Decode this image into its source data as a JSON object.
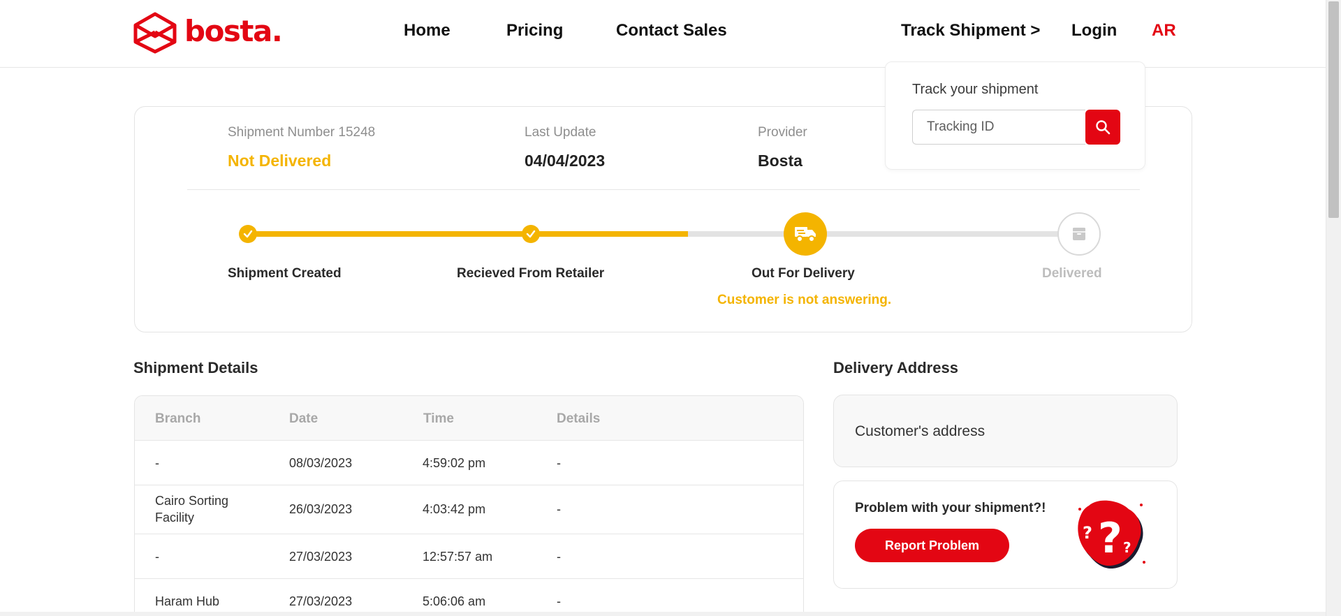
{
  "header": {
    "logo_text": "bosta",
    "nav": {
      "home": "Home",
      "pricing": "Pricing",
      "contact_sales": "Contact Sales",
      "track_shipment": "Track Shipment >",
      "login": "Login",
      "language": "AR"
    }
  },
  "track_popup": {
    "title": "Track your shipment",
    "input_placeholder": "Tracking ID",
    "search_icon": "search-icon"
  },
  "shipment": {
    "number_label": "Shipment Number 15248",
    "status": "Not Delivered",
    "last_update_label": "Last Update",
    "last_update_value": "04/04/2023",
    "provider_label": "Provider",
    "provider_value": "Bosta"
  },
  "progress": {
    "steps": [
      {
        "label": "Shipment Created",
        "state": "done",
        "icon": "check-icon"
      },
      {
        "label": "Recieved From Retailer",
        "state": "done",
        "icon": "check-icon"
      },
      {
        "label": "Out For Delivery",
        "state": "current",
        "icon": "delivery-truck-icon"
      },
      {
        "label": "Delivered",
        "state": "pending",
        "icon": "package-icon"
      }
    ],
    "note": "Customer is not answering."
  },
  "details": {
    "title": "Shipment Details",
    "columns": [
      "Branch",
      "Date",
      "Time",
      "Details"
    ],
    "rows": [
      {
        "branch": "-",
        "date": "08/03/2023",
        "time": "4:59:02 pm",
        "details": "-"
      },
      {
        "branch": "Cairo Sorting Facility",
        "date": "26/03/2023",
        "time": "4:03:42 pm",
        "details": "-"
      },
      {
        "branch": "-",
        "date": "27/03/2023",
        "time": "12:57:57 am",
        "details": "-"
      },
      {
        "branch": "Haram Hub",
        "date": "27/03/2023",
        "time": "5:06:06 am",
        "details": "-"
      }
    ]
  },
  "delivery": {
    "title": "Delivery Address",
    "address": "Customer's address",
    "problem_text": "Problem with your shipment?!",
    "report_button": "Report Problem"
  },
  "colors": {
    "brand_red": "#e30613",
    "progress_yellow": "#f4b400",
    "muted_grey": "#bdbdbd"
  }
}
